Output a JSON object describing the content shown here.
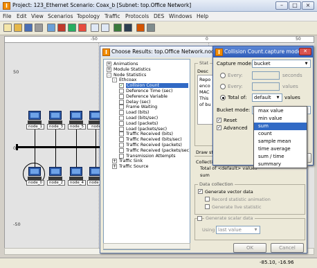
{
  "window": {
    "title": "Project: 123_Ethernet Scenario: Coax_b [Subnet: top.Office Network]"
  },
  "menu": [
    "File",
    "Edit",
    "View",
    "Scenarios",
    "Topology",
    "Traffic",
    "Protocols",
    "DES",
    "Windows",
    "Help"
  ],
  "ruler": {
    "ticks": [
      "-50",
      "0",
      "50"
    ]
  },
  "canvas": {
    "y_labels": [
      "50",
      "0",
      "-50"
    ],
    "top_row": [
      "node_1",
      "node_3",
      "node_5",
      "node"
    ],
    "bottom_row": [
      "node_0",
      "node_2",
      "node_4",
      "node_6"
    ]
  },
  "status": {
    "coords": "-85.10, -16.96"
  },
  "results": {
    "title": "Choose Results: top.Office Network.node_0",
    "tree": [
      {
        "label": "Animations",
        "level": 0,
        "expander": "+"
      },
      {
        "label": "Module Statistics",
        "level": 0,
        "expander": "+"
      },
      {
        "label": "Node Statistics",
        "level": 0,
        "expander": "-"
      },
      {
        "label": "Ethcoax",
        "level": 1,
        "expander": "-"
      },
      {
        "label": "Collision Count",
        "level": 2,
        "checked": true,
        "selected": true
      },
      {
        "label": "Deference Time (sec)",
        "level": 2
      },
      {
        "label": "Deference Variable",
        "level": 2
      },
      {
        "label": "Delay (sec)",
        "level": 2
      },
      {
        "label": "Frame Waiting",
        "level": 2
      },
      {
        "label": "Load (bits)",
        "level": 2
      },
      {
        "label": "Load (bits/sec)",
        "level": 2
      },
      {
        "label": "Load (packets)",
        "level": 2
      },
      {
        "label": "Load (packets/sec)",
        "level": 2
      },
      {
        "label": "Traffic Received (bits)",
        "level": 2
      },
      {
        "label": "Traffic Received (bits/sec)",
        "level": 2
      },
      {
        "label": "Traffic Received (packets)",
        "level": 2
      },
      {
        "label": "Traffic Received (packets/sec)",
        "level": 2
      },
      {
        "label": "Transmission Attempts",
        "level": 2
      },
      {
        "label": "Traffic Sink",
        "level": 1,
        "expander": "+"
      },
      {
        "label": "Traffic Source",
        "level": 1,
        "expander": "+"
      }
    ],
    "stat_caption": "Stat",
    "desc_caption": "Desc",
    "desc_lines": [
      "Repo",
      "enco",
      "MAC",
      "This",
      "of bu"
    ],
    "draw_style": "Draw style: linear",
    "collection_mode": "Collection mode: Bucke",
    "total_of": "Total of <default> values",
    "sum": "sum",
    "data_collection": "Data collection",
    "generate_vector": "Generate vector data",
    "record_animation": "Record statistic animation",
    "generate_live": "Generate live statistic",
    "generate_scalar": "Generate scalar data",
    "using": "Using",
    "using_value": "last value",
    "ok": "OK",
    "cancel": "Cancel"
  },
  "capture": {
    "title": "Collision Count.capture mode",
    "capture_mode_label": "Capture mode:",
    "capture_mode_value": "bucket",
    "every_label": "Every:",
    "seconds": "seconds",
    "every2_label": "Every:",
    "values": "values",
    "total_of_label": "Total of:",
    "total_of_value": "default",
    "total_values": "values",
    "bucket_mode_label": "Bucket mode:",
    "bucket_mode_value": "sum",
    "reset_label": "Reset",
    "advanced_label": "Advanced",
    "cancel_fragment": "el"
  },
  "dropdown": {
    "options": [
      "max value",
      "min value",
      "sum",
      "count",
      "sample mean",
      "time average",
      "sum / time",
      "summary"
    ],
    "selected_index": 2
  }
}
